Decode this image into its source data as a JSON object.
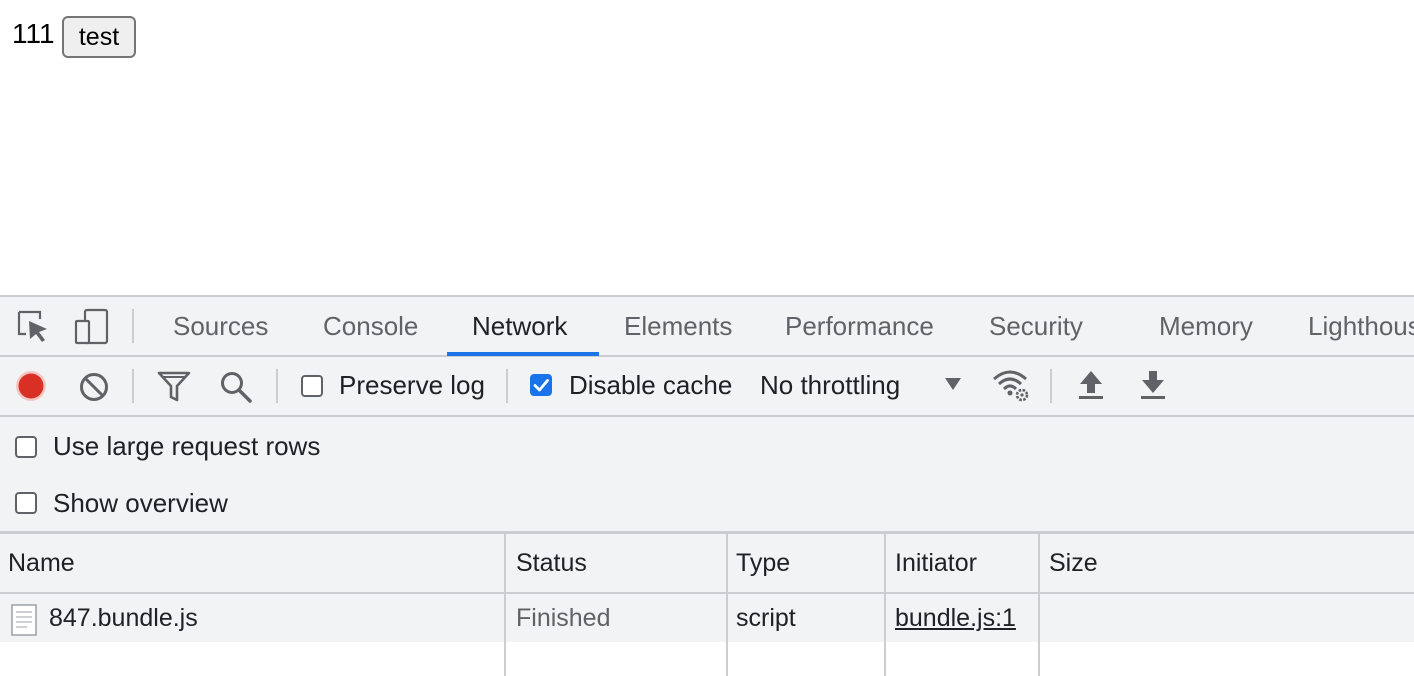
{
  "page": {
    "text": "111",
    "button_label": "test"
  },
  "devtools": {
    "tabs": [
      {
        "label": "Sources"
      },
      {
        "label": "Console"
      },
      {
        "label": "Network",
        "active": true
      },
      {
        "label": "Elements"
      },
      {
        "label": "Performance"
      },
      {
        "label": "Security"
      },
      {
        "label": "Memory"
      },
      {
        "label": "Lighthouse"
      }
    ],
    "toolbar": {
      "preserve_log": {
        "label": "Preserve log",
        "checked": false
      },
      "disable_cache": {
        "label": "Disable cache",
        "checked": true
      },
      "throttling": "No throttling"
    },
    "settings": {
      "large_rows": {
        "label": "Use large request rows",
        "checked": false
      },
      "overview": {
        "label": "Show overview",
        "checked": false
      }
    },
    "table": {
      "columns": [
        "Name",
        "Status",
        "Type",
        "Initiator",
        "Size"
      ],
      "rows": [
        {
          "name": "847.bundle.js",
          "status": "Finished",
          "type": "script",
          "initiator": "bundle.js:1",
          "size": ""
        }
      ]
    },
    "colors": {
      "accent": "#1a73e8",
      "record": "#d93025",
      "panel_bg": "#f1f3f4"
    }
  }
}
